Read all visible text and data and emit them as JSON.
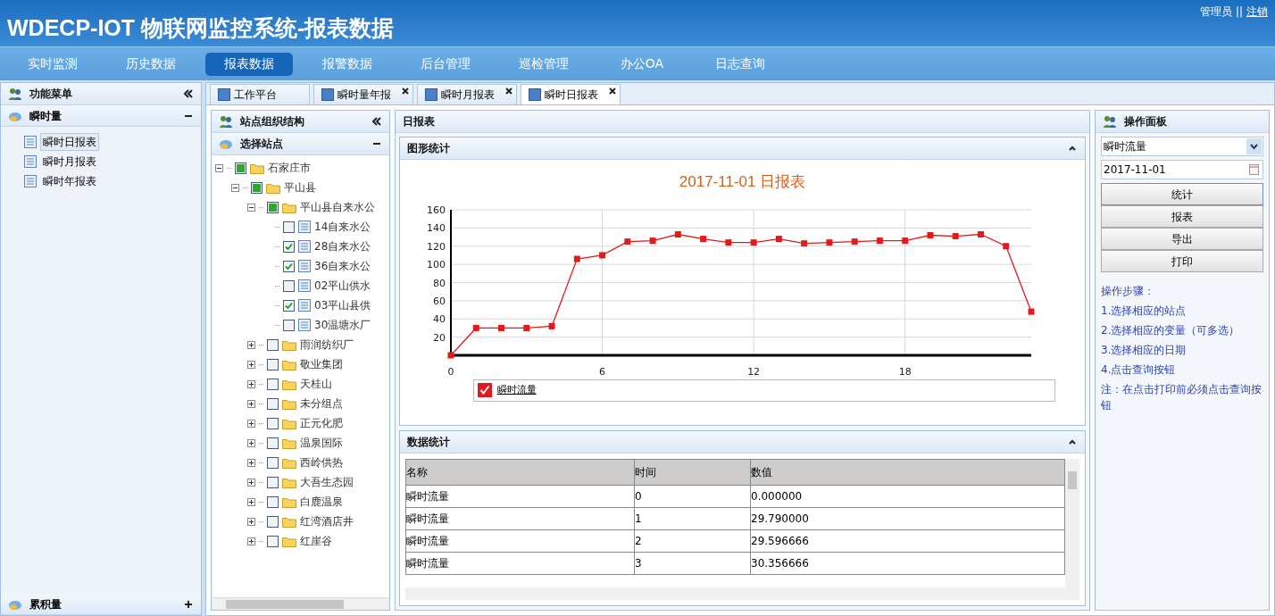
{
  "header": {
    "title": "WDECP-IOT 物联网监控系统-报表数据",
    "user": "管理员",
    "separator": "||",
    "logout": "注销"
  },
  "nav": [
    {
      "label": "实时监测",
      "selected": false
    },
    {
      "label": "历史数据",
      "selected": false
    },
    {
      "label": "报表数据",
      "selected": true
    },
    {
      "label": "报警数据",
      "selected": false
    },
    {
      "label": "后台管理",
      "selected": false
    },
    {
      "label": "巡检管理",
      "selected": false
    },
    {
      "label": "办公OA",
      "selected": false
    },
    {
      "label": "日志查询",
      "selected": false
    }
  ],
  "sidebar": {
    "title": "功能菜单",
    "sections": [
      {
        "title": "瞬时量",
        "expanded": true,
        "items": [
          {
            "label": "瞬时日报表",
            "selected": true
          },
          {
            "label": "瞬时月报表",
            "selected": false
          },
          {
            "label": "瞬时年报表",
            "selected": false
          }
        ]
      },
      {
        "title": "累积量",
        "expanded": false
      }
    ]
  },
  "tabs": [
    {
      "label": "工作平台",
      "closable": false,
      "selected": false
    },
    {
      "label": "瞬时量年报",
      "closable": true,
      "selected": false
    },
    {
      "label": "瞬时月报表",
      "closable": true,
      "selected": false
    },
    {
      "label": "瞬时日报表",
      "closable": true,
      "selected": true
    }
  ],
  "tree_panel": {
    "title": "站点组织结构",
    "section": "选择站点",
    "nodes": [
      {
        "label": "石家庄市",
        "kind": "folder",
        "expanded": true,
        "checked": false,
        "partial": true,
        "children": [
          {
            "label": "平山县",
            "kind": "folder",
            "expanded": true,
            "checked": false,
            "partial": true,
            "children": [
              {
                "label": "平山县自来水公",
                "kind": "folder",
                "expanded": true,
                "checked": false,
                "partial": true,
                "children": [
                  {
                    "label": "14自来水公",
                    "kind": "station",
                    "checked": false
                  },
                  {
                    "label": "28自来水公",
                    "kind": "station",
                    "checked": true
                  },
                  {
                    "label": "36自来水公",
                    "kind": "station",
                    "checked": true
                  },
                  {
                    "label": "02平山供水",
                    "kind": "station",
                    "checked": false
                  },
                  {
                    "label": "03平山县供",
                    "kind": "station",
                    "checked": true
                  },
                  {
                    "label": "30温塘水厂",
                    "kind": "station",
                    "checked": false
                  }
                ]
              },
              {
                "label": "雨润纺织厂",
                "kind": "folder",
                "expanded": false,
                "checked": false,
                "partial": false
              },
              {
                "label": "敬业集团",
                "kind": "folder",
                "expanded": false,
                "checked": false,
                "partial": false
              },
              {
                "label": "天桂山",
                "kind": "folder",
                "expanded": false,
                "checked": false,
                "partial": false
              },
              {
                "label": "未分组点",
                "kind": "folder",
                "expanded": false,
                "checked": false,
                "partial": false
              },
              {
                "label": "正元化肥",
                "kind": "folder",
                "expanded": false,
                "checked": false,
                "partial": false
              },
              {
                "label": "温泉国际",
                "kind": "folder",
                "expanded": false,
                "checked": false,
                "partial": false
              },
              {
                "label": "西岭供热",
                "kind": "folder",
                "expanded": false,
                "checked": false,
                "partial": false
              },
              {
                "label": "大吾生态园",
                "kind": "folder",
                "expanded": false,
                "checked": false,
                "partial": false
              },
              {
                "label": "白鹿温泉",
                "kind": "folder",
                "expanded": false,
                "checked": false,
                "partial": false
              },
              {
                "label": "红湾酒店井",
                "kind": "folder",
                "expanded": false,
                "checked": false,
                "partial": false
              },
              {
                "label": "红崖谷",
                "kind": "folder",
                "expanded": false,
                "checked": false,
                "partial": false
              }
            ]
          }
        ]
      }
    ]
  },
  "report": {
    "title": "日报表",
    "chart_panel": {
      "title": "图形统计",
      "chart_title": "2017-11-01 日报表",
      "legend": {
        "checked": true
      },
      "chart_data": {
        "type": "line",
        "x": [
          0,
          1,
          2,
          3,
          4,
          5,
          6,
          7,
          8,
          9,
          10,
          11,
          12,
          13,
          14,
          15,
          16,
          17,
          18,
          19,
          20,
          21,
          22,
          23
        ],
        "series": [
          {
            "name": "瞬时流量",
            "color": "#e31a1c",
            "marker": "square",
            "values": [
              0,
              30,
              30,
              30,
              32,
              106,
              110,
              125,
              126,
              133,
              128,
              124,
              124,
              128,
              123,
              124,
              125,
              126,
              126,
              132,
              131,
              133,
              120,
              48
            ]
          }
        ],
        "grid": true,
        "xlim": [
          0,
          23
        ],
        "ylim": [
          0,
          160
        ],
        "xticks": [
          0,
          6,
          12,
          18
        ],
        "yticks": [
          20,
          40,
          60,
          80,
          100,
          120,
          140,
          160
        ]
      }
    },
    "data_panel": {
      "title": "数据统计",
      "columns": [
        "名称",
        "时间",
        "数值"
      ],
      "rows": [
        [
          "瞬时流量",
          "0",
          "0.000000"
        ],
        [
          "瞬时流量",
          "1",
          "29.790000"
        ],
        [
          "瞬时流量",
          "2",
          "29.596666"
        ],
        [
          "瞬时流量",
          "3",
          "30.356666"
        ]
      ]
    }
  },
  "ops_panel": {
    "title": "操作面板",
    "variable": "瞬时流量",
    "date": "2017-11-01",
    "buttons": [
      {
        "label": "统计",
        "selected": true
      },
      {
        "label": "报表",
        "selected": false
      },
      {
        "label": "导出",
        "selected": false
      },
      {
        "label": "打印",
        "selected": false
      }
    ],
    "steps": [
      "操作步骤：",
      "1.选择相应的站点",
      "2.选择相应的变量（可多选）",
      "3.选择相应的日期",
      "4.点击查询按钮",
      "注：在点击打印前必须点击查询按钮"
    ]
  }
}
